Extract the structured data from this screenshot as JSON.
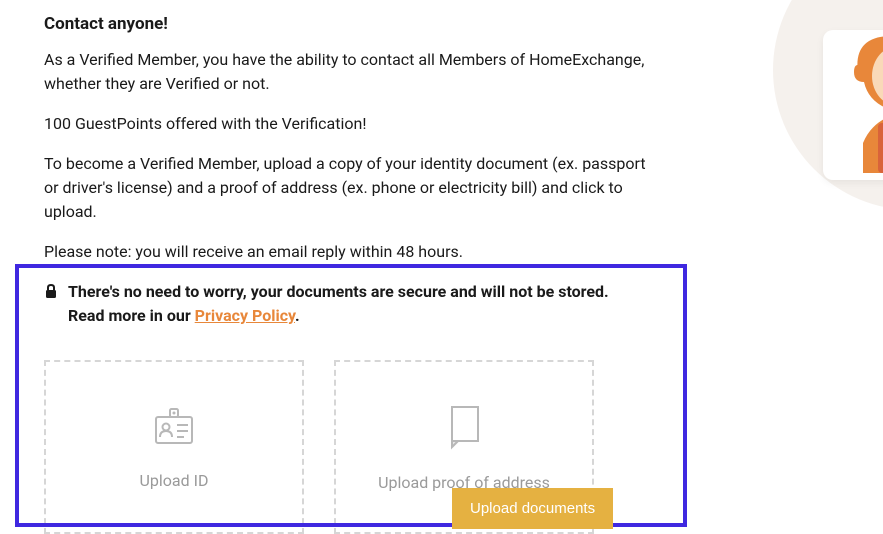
{
  "heading": "Contact anyone!",
  "paragraphs": {
    "p1": "As a Verified Member, you have the ability to contact all Members of HomeExchange, whether they are Verified or not.",
    "p2": "100 GuestPoints offered with the Verification!",
    "p3": "To become a Verified Member, upload a copy of your identity document (ex. passport or driver's license) and a proof of address (ex. phone or electricity bill) and click to upload.",
    "p4": "Please note: you will receive an email reply within 48 hours."
  },
  "secure": {
    "line1": "There's no need to worry, your documents are secure and will not be stored.",
    "read_more_prefix": "Read more in our ",
    "privacy_link_text": "Privacy Policy",
    "suffix": "."
  },
  "uploads": {
    "id_label": "Upload ID",
    "address_label": "Upload proof of address",
    "button_label": "Upload documents"
  }
}
